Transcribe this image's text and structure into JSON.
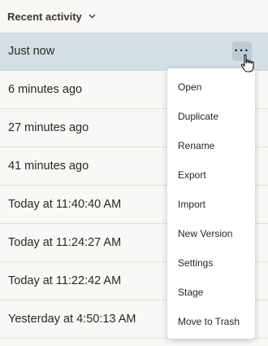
{
  "header": {
    "title": "Recent activity",
    "chevron_icon": "chevron-down-icon"
  },
  "rows": [
    {
      "label": "Just now",
      "selected": true
    },
    {
      "label": "6 minutes ago"
    },
    {
      "label": "27 minutes ago"
    },
    {
      "label": "41 minutes ago"
    },
    {
      "label": "Today at 11:40:40 AM"
    },
    {
      "label": "Today at 11:24:27 AM"
    },
    {
      "label": "Today at 11:22:42 AM"
    },
    {
      "label": "Yesterday at 4:50:13 AM"
    }
  ],
  "more_button": {
    "label": "···",
    "icon": "more-horizontal-icon"
  },
  "menu": {
    "items": [
      "Open",
      "Duplicate",
      "Rename",
      "Export",
      "Import",
      "New Version",
      "Settings",
      "Stage",
      "Move to Trash"
    ]
  },
  "colors": {
    "selected_row": "#d3dee5",
    "more_button_bg": "#bccbd6",
    "background": "#f9f8f6"
  }
}
